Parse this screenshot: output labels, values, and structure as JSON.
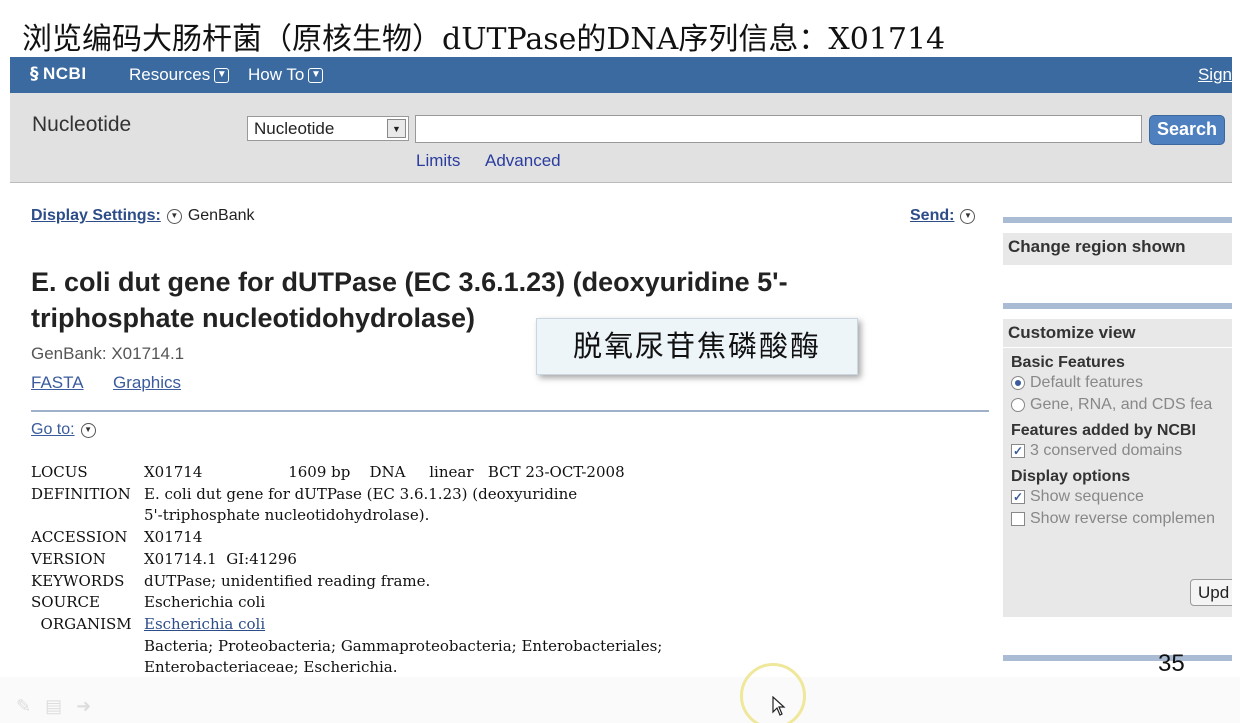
{
  "slide": {
    "title": "浏览编码大肠杆菌（原核生物）dUTPase的DNA序列信息：X01714",
    "overlay_label": "脱氧尿苷焦磷酸酶",
    "page_number": "35"
  },
  "ncbi": {
    "logo": "NCBI",
    "menu": [
      "Resources",
      "How To"
    ],
    "signin": "Sign"
  },
  "search": {
    "db_label": "Nucleotide",
    "db_select_value": "Nucleotide",
    "query_value": "",
    "button": "Search",
    "links": [
      "Limits",
      "Advanced"
    ]
  },
  "record_header": {
    "display_settings": "Display Settings:",
    "format": "GenBank",
    "send": "Send:",
    "title": "E. coli dut gene for dUTPase (EC 3.6.1.23) (deoxyuridine 5'-triphosphate nucleotidohydrolase)",
    "genbank_id": "GenBank: X01714.1",
    "format_links": [
      "FASTA",
      "Graphics"
    ],
    "goto": "Go to:"
  },
  "genbank": {
    "locus_key": "LOCUS",
    "locus_val": "X01714                  1609 bp    DNA     linear   BCT 23-OCT-2008",
    "definition_key": "DEFINITION",
    "definition_val1": "E. coli dut gene for dUTPase (EC 3.6.1.23) (deoxyuridine",
    "definition_val2": "5'-triphosphate nucleotidohydrolase).",
    "accession_key": "ACCESSION",
    "accession_val": "X01714",
    "version_key": "VERSION",
    "version_val": "X01714.1  GI:41296",
    "keywords_key": "KEYWORDS",
    "keywords_val": "dUTPase; unidentified reading frame.",
    "source_key": "SOURCE",
    "source_val": "Escherichia coli",
    "organism_key": "  ORGANISM",
    "organism_val": "Escherichia coli",
    "lineage1": "Bacteria; Proteobacteria; Gammaproteobacteria; Enterobacteriales;",
    "lineage2": "Enterobacteriaceae; Escherichia."
  },
  "sidebar": {
    "change_region": "Change region shown",
    "customize_view": "Customize view",
    "basic_features": "Basic Features",
    "opt_default": "Default features",
    "opt_gene": "Gene, RNA, and CDS fea",
    "features_added": "Features added by NCBI",
    "opt_domains": "3 conserved domains",
    "display_options": "Display options",
    "opt_show_seq": "Show sequence",
    "opt_show_rev": "Show reverse complemen",
    "update_button": "Upd"
  },
  "colors": {
    "ncbi_blue": "#3b6aa0",
    "search_button": "#4e7fbf",
    "link": "#3a5b9c"
  },
  "icons": [
    "dna-helix-icon",
    "chevron-down-icon",
    "select-arrow-icon",
    "mouse-cursor-icon",
    "pen-icon",
    "slides-icon",
    "arrow-right-icon"
  ]
}
